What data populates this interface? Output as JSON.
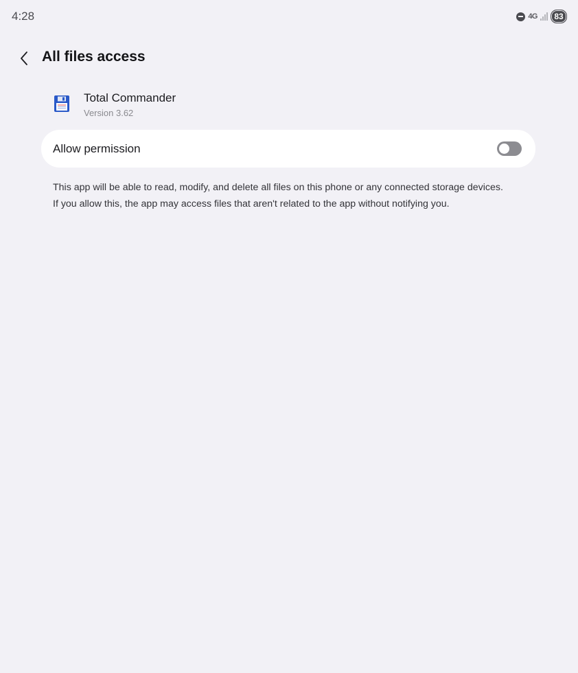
{
  "status_bar": {
    "time": "4:28",
    "network": "4G",
    "battery": "83",
    "icons": [
      "do-not-disturb-icon",
      "signal-icon"
    ]
  },
  "header": {
    "back_icon": "chevron-left-icon",
    "title": "All files access"
  },
  "app": {
    "icon": "floppy-disk-icon",
    "name": "Total Commander",
    "version": "Version 3.62"
  },
  "permission": {
    "label": "Allow permission",
    "enabled": false
  },
  "description": {
    "line1": "This app will be able to read, modify, and delete all files on this phone or any connected storage devices.",
    "line2": "If you allow this, the app may access files that aren't related to the app without notifying you."
  },
  "colors": {
    "background": "#f2f1f6",
    "card": "#ffffff",
    "toggle_off": "#8c8c91",
    "app_icon_blue": "#2a59c8"
  }
}
